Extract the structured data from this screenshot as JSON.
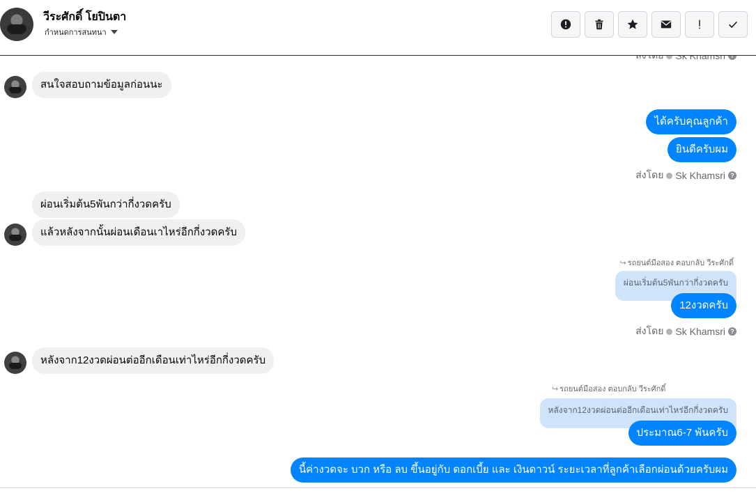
{
  "header": {
    "contact_name": "วีระศักดิ์ โยปินตา",
    "subtitle": "กำหนดการสนทนา",
    "toolbar": [
      {
        "name": "report-icon",
        "label": "report"
      },
      {
        "name": "trash-icon",
        "label": "delete"
      },
      {
        "name": "star-icon",
        "label": "star"
      },
      {
        "name": "envelope-icon",
        "label": "mark unread"
      },
      {
        "name": "exclamation-icon",
        "label": "important"
      },
      {
        "name": "check-icon",
        "label": "done"
      }
    ]
  },
  "sent_by": {
    "prefix": "ส่งโดย",
    "agent": "Sk Khamsri",
    "help": "?"
  },
  "messages": {
    "in_1": "สนใจสอบถามข้อมูลก่อนนะ",
    "out_1": "ได้ครับคุณลูกค้า",
    "out_2": "ยินดีครับผม",
    "in_2": "ผ่อนเริ่มต้น5พันกว่ากี่งวดครับ",
    "in_3": "แล้วหลังจากนั้นผ่อนเดือนเาไหร่อีกกี่งวดครับ",
    "reply_1_label": "รถยนต์มือสอง ตอบกลับ วีระศักดิ์",
    "reply_1_quote": "ผ่อนเริ่มต้น5พันกว่ากี่งวดครับ",
    "out_3": "12งวดครับ",
    "in_4": "หลังจาก12งวดผ่อนต่ออีกเดือนเท่าไหร่อีกกี่งวดครับ",
    "reply_2_label": "รถยนต์มือสอง ตอบกลับ วีระศักดิ์",
    "reply_2_quote": "หลังจาก12งวดผ่อนต่ออีกเดือนเท่าไหร่อีกกี่งวดครับ",
    "out_4": "ประมาณ6-7 พันครับ",
    "out_5": "นี้ค่างวดจะ บวก หรือ ลบ ขึ้นอยู่กับ ดอกเบี้ย และ เงินดาวน์ ระยะเวลาที่ลูกค้าเลือกผ่อนด้วยครับผม"
  },
  "colors": {
    "outgoing_bubble": "#0084ff",
    "incoming_bubble": "#f0f0f0",
    "quote_bubble": "#cfe3fb"
  }
}
